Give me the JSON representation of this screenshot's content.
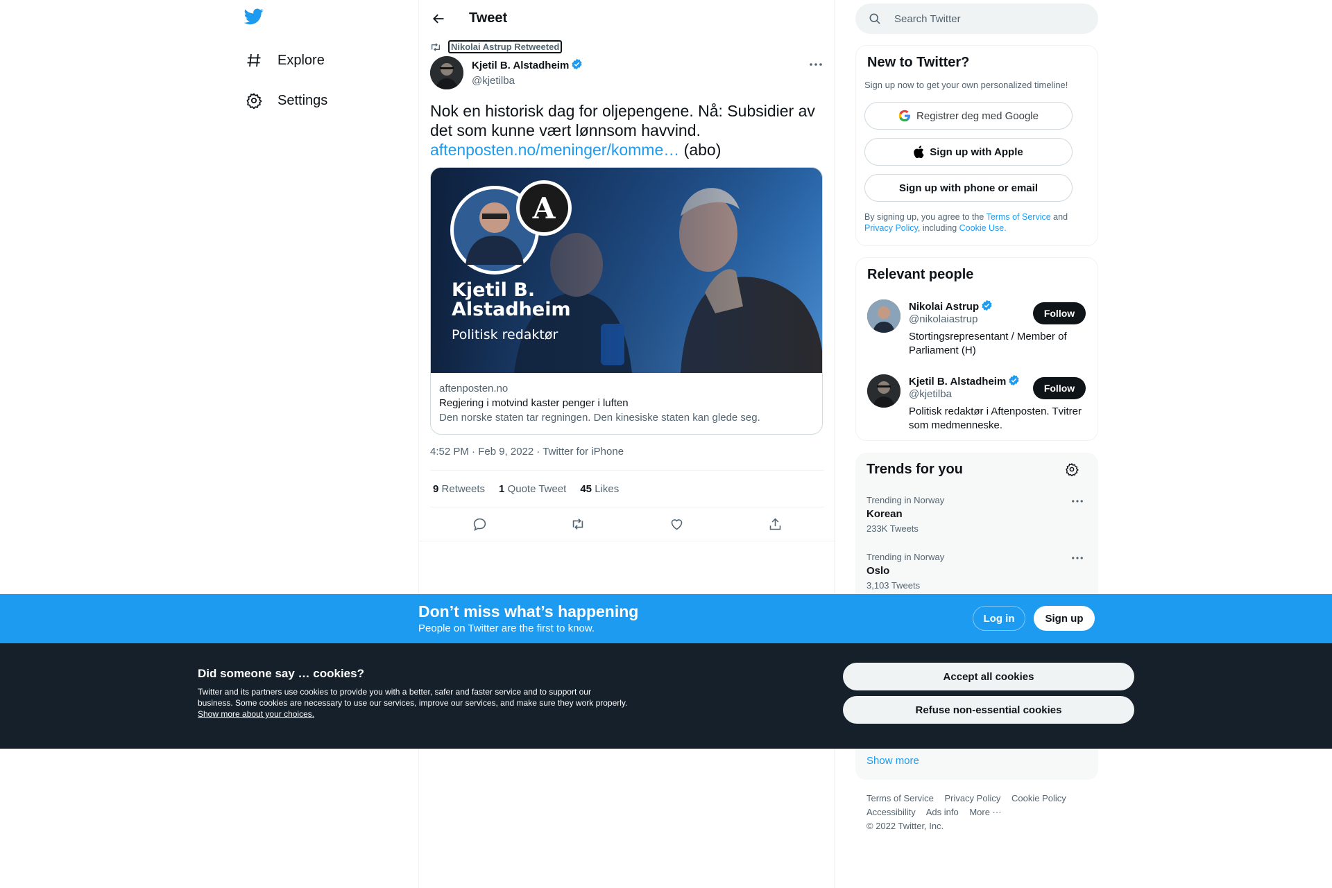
{
  "nav": {
    "explore": "Explore",
    "settings": "Settings"
  },
  "header": {
    "title": "Tweet"
  },
  "tweet": {
    "retweeted_by": "Nikolai Astrup Retweeted",
    "author_name": "Kjetil B. Alstadheim",
    "author_handle": "@kjetilba",
    "text": "Nok en historisk dag for oljepengene. Nå: Subsidier av det som kunne vært lønnsom havvind.",
    "link": "aftenposten.no/meninger/komme…",
    "suffix": " (abo)",
    "card": {
      "overlay_name_line1": "Kjetil B.",
      "overlay_name_line2": "Alstadheim",
      "overlay_role": "Politisk redaktør",
      "domain": "aftenposten.no",
      "title": "Regjering i motvind kaster penger i luften",
      "description": "Den norske staten tar regningen. Den kinesiske staten kan glede seg."
    },
    "timestamp": "4:52 PM · Feb 9, 2022 · Twitter for iPhone",
    "retweets_count": "9",
    "retweets_label": "Retweets",
    "quotes_count": "1",
    "quotes_label": "Quote Tweet",
    "likes_count": "45",
    "likes_label": "Likes"
  },
  "search": {
    "placeholder": "Search Twitter"
  },
  "new_to_twitter": {
    "title": "New to Twitter?",
    "subtitle": "Sign up now to get your own personalized timeline!",
    "google": "Registrer deg med Google",
    "apple": "Sign up with Apple",
    "phone": "Sign up with phone or email",
    "legal_prefix": "By signing up, you agree to the ",
    "terms": "Terms of Service",
    "and": " and ",
    "privacy": "Privacy Policy",
    "including": ", including ",
    "cookie_use": "Cookie Use."
  },
  "relevant_people": {
    "title": "Relevant people",
    "people": [
      {
        "name": "Nikolai Astrup",
        "handle": "@nikolaiastrup",
        "bio": "Stortingsrepresentant / Member of Parliament (H)",
        "follow": "Follow"
      },
      {
        "name": "Kjetil B. Alstadheim",
        "handle": "@kjetilba",
        "bio": "Politisk redaktør i Aftenposten. Tvitrer som medmenneske.",
        "follow": "Follow"
      }
    ]
  },
  "trends": {
    "title": "Trends for you",
    "items": [
      {
        "context": "Trending in Norway",
        "name": "Korean",
        "count": "233K Tweets"
      },
      {
        "context": "Trending in Norway",
        "name": "Oslo",
        "count": "3,103 Tweets"
      }
    ],
    "show_more": "Show more"
  },
  "footer": {
    "terms": "Terms of Service",
    "privacy": "Privacy Policy",
    "cookie": "Cookie Policy",
    "accessibility": "Accessibility",
    "ads": "Ads info",
    "more": "More ···",
    "copyright": "© 2022 Twitter, Inc."
  },
  "banner": {
    "heading": "Don’t miss what’s happening",
    "sub": "People on Twitter are the first to know.",
    "login": "Log in",
    "signup": "Sign up"
  },
  "cookies": {
    "heading": "Did someone say … cookies?",
    "body": "Twitter and its partners use cookies to provide you with a better, safer and faster service and to support our business. Some cookies are necessary to use our services, improve our services, and make sure they work properly. ",
    "link": "Show more about your choices.",
    "accept": "Accept all cookies",
    "refuse": "Refuse non-essential cookies"
  },
  "colors": {
    "accent": "#1d9bf0",
    "text": "#0f1419",
    "secondary": "#536471",
    "cookie_bg": "#15202b"
  }
}
